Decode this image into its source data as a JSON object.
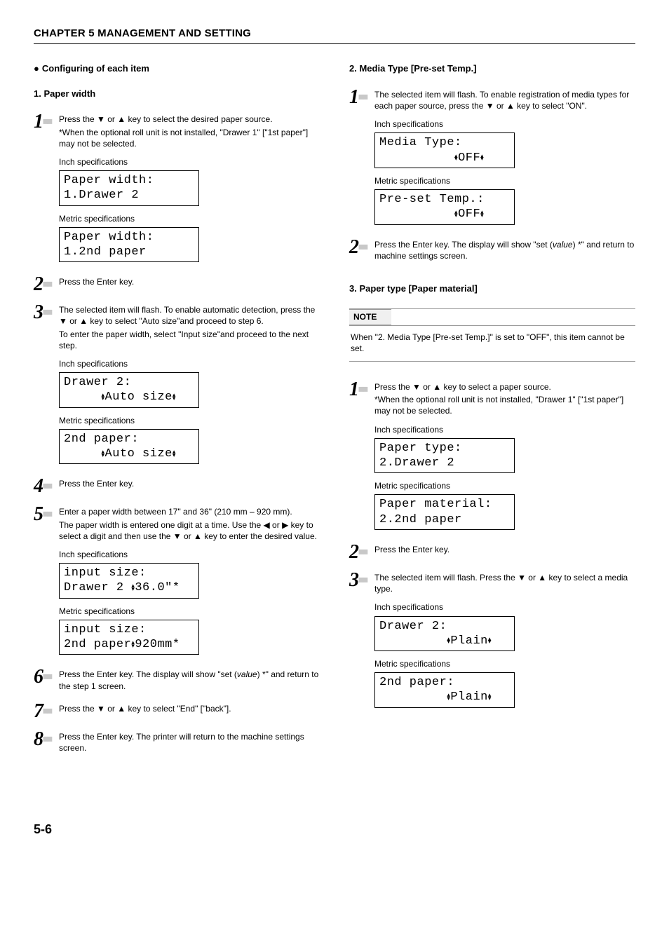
{
  "chapter_title": "CHAPTER 5  MANAGEMENT AND SETTING",
  "page_number": "5-6",
  "left": {
    "config_heading": "Configuring of each item",
    "sec1_heading": "1. Paper width",
    "step1": {
      "p1": "Press the ▼ or ▲ key to select the desired paper source.",
      "p2": "*When the optional roll unit is not installed, \"Drawer 1\" [\"1st paper\"] may not be selected.",
      "inch_label": "Inch specifications",
      "inch_l1": "Paper width:",
      "inch_l2": "1.Drawer 2",
      "metric_label": "Metric specifications",
      "metric_l1": "Paper width:",
      "metric_l2": "1.2nd paper"
    },
    "step2": {
      "p1": "Press the Enter key."
    },
    "step3": {
      "p1": "The selected item will flash. To enable automatic detection, press the ▼ or ▲ key to select \"Auto size\"and proceed to step 6.",
      "p2": "To enter the paper width, select \"Input size\"and proceed to the next step.",
      "inch_label": "Inch specifications",
      "inch_l1": "Drawer 2:",
      "inch_l2": "Auto size",
      "metric_label": "Metric specifications",
      "metric_l1": "2nd paper:",
      "metric_l2": "Auto size"
    },
    "step4": {
      "p1": "Press the Enter key."
    },
    "step5": {
      "p1": "Enter a paper width between 17\" and 36\" (210 mm – 920 mm).",
      "p2": "The paper width is entered one digit at a time. Use the ◀ or ▶ key to select a digit and then use the ▼ or ▲ key to enter the desired value.",
      "inch_label": "Inch specifications",
      "inch_l1": "input size:",
      "inch_l2a": "Drawer 2 ",
      "inch_l2b": "36.0\"*",
      "metric_label": "Metric specifications",
      "metric_l1": "input size:",
      "metric_l2a": "2nd paper",
      "metric_l2b": "920mm*"
    },
    "step6": {
      "p1a": "Press the Enter key. The display will show \"set (",
      "p1i": "value",
      "p1b": ") *\" and return to the step 1 screen."
    },
    "step7": {
      "p1": "Press the ▼ or ▲ key to select \"End\" [\"back\"]."
    },
    "step8": {
      "p1": "Press the Enter key. The printer will return to the machine settings screen."
    }
  },
  "right": {
    "sec2_heading": "2. Media Type [Pre-set Temp.]",
    "step1": {
      "p1": "The selected item will flash. To enable registration of media types for each paper source, press the ▼ or ▲ key to select \"ON\".",
      "inch_label": "Inch specifications",
      "inch_l1": "Media Type:",
      "inch_l2": "OFF",
      "metric_label": "Metric specifications",
      "metric_l1": "Pre-set Temp.:",
      "metric_l2": "OFF"
    },
    "step2": {
      "p1a": "Press the Enter key. The display will show \"set (",
      "p1i": "value",
      "p1b": ") *\" and return to machine settings screen."
    },
    "sec3_heading": "3. Paper type [Paper material]",
    "note_label": "NOTE",
    "note_body": "When \"2. Media Type [Pre-set Temp.]\" is set to \"OFF\", this item cannot be set.",
    "s3step1": {
      "p1": "Press the ▼ or ▲ key to select a paper source.",
      "p2": "*When the optional roll unit is not installed, \"Drawer 1\" [\"1st paper\"] may not be selected.",
      "inch_label": "Inch specifications",
      "inch_l1": "Paper type:",
      "inch_l2": "2.Drawer 2",
      "metric_label": "Metric specifications",
      "metric_l1": "Paper material:",
      "metric_l2": "2.2nd paper"
    },
    "s3step2": {
      "p1": "Press the Enter key."
    },
    "s3step3": {
      "p1": "The selected item will flash. Press the ▼ or ▲ key to select a media type.",
      "inch_label": "Inch specifications",
      "inch_l1": "Drawer 2:",
      "inch_l2": "Plain",
      "metric_label": "Metric specifications",
      "metric_l1": "2nd paper:",
      "metric_l2": "Plain"
    }
  }
}
